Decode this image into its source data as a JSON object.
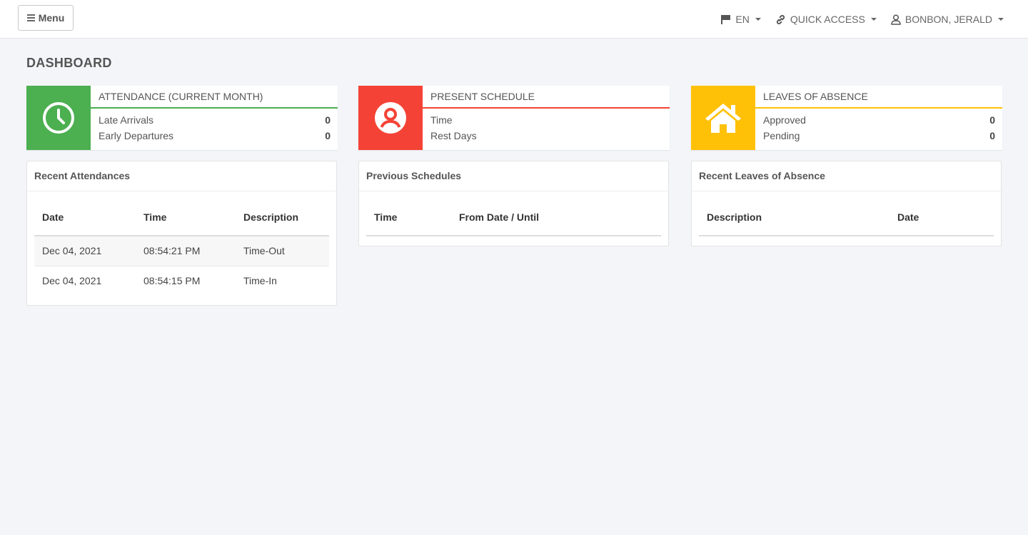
{
  "navbar": {
    "menu_label": "Menu",
    "language": "EN",
    "quick_access": "QUICK ACCESS",
    "user": "BONBON, JERALD"
  },
  "page": {
    "title": "DASHBOARD"
  },
  "colors": {
    "green": "#4caf50",
    "red": "#f44336",
    "yellow": "#ffc107"
  },
  "info_boxes": [
    {
      "title": "ATTENDANCE (CURRENT MONTH)",
      "icon": "clock-icon",
      "rows": [
        {
          "label": "Late Arrivals",
          "value": "0"
        },
        {
          "label": "Early Departures",
          "value": "0"
        }
      ]
    },
    {
      "title": "PRESENT SCHEDULE",
      "icon": "user-circle-icon",
      "rows": [
        {
          "label": "Time",
          "value": ""
        },
        {
          "label": "Rest Days",
          "value": ""
        }
      ]
    },
    {
      "title": "LEAVES OF ABSENCE",
      "icon": "home-icon",
      "rows": [
        {
          "label": "Approved",
          "value": "0"
        },
        {
          "label": "Pending",
          "value": "0"
        }
      ]
    }
  ],
  "recent_attendances": {
    "title": "Recent Attendances",
    "columns": [
      "Date",
      "Time",
      "Description"
    ],
    "rows": [
      [
        "Dec 04, 2021",
        "08:54:21 PM",
        "Time-Out"
      ],
      [
        "Dec 04, 2021",
        "08:54:15 PM",
        "Time-In"
      ]
    ]
  },
  "previous_schedules": {
    "title": "Previous Schedules",
    "columns": [
      "Time",
      "From Date / Until"
    ]
  },
  "recent_leaves": {
    "title": "Recent Leaves of Absence",
    "columns": [
      "Description",
      "Date"
    ]
  }
}
